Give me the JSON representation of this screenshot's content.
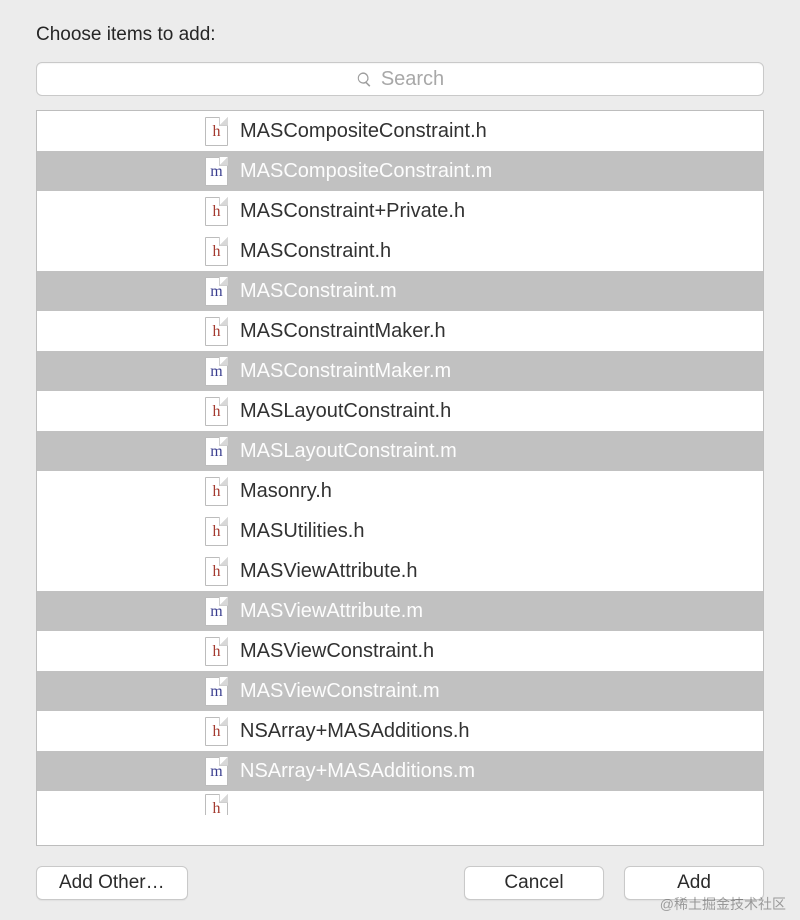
{
  "title": "Choose items to add:",
  "search": {
    "placeholder": "Search"
  },
  "files": [
    {
      "name": "MASCompositeConstraint.h",
      "kind": "h",
      "selected": false
    },
    {
      "name": "MASCompositeConstraint.m",
      "kind": "m",
      "selected": true
    },
    {
      "name": "MASConstraint+Private.h",
      "kind": "h",
      "selected": false
    },
    {
      "name": "MASConstraint.h",
      "kind": "h",
      "selected": false
    },
    {
      "name": "MASConstraint.m",
      "kind": "m",
      "selected": true
    },
    {
      "name": "MASConstraintMaker.h",
      "kind": "h",
      "selected": false
    },
    {
      "name": "MASConstraintMaker.m",
      "kind": "m",
      "selected": true
    },
    {
      "name": "MASLayoutConstraint.h",
      "kind": "h",
      "selected": false
    },
    {
      "name": "MASLayoutConstraint.m",
      "kind": "m",
      "selected": true
    },
    {
      "name": "Masonry.h",
      "kind": "h",
      "selected": false
    },
    {
      "name": "MASUtilities.h",
      "kind": "h",
      "selected": false
    },
    {
      "name": "MASViewAttribute.h",
      "kind": "h",
      "selected": false
    },
    {
      "name": "MASViewAttribute.m",
      "kind": "m",
      "selected": true
    },
    {
      "name": "MASViewConstraint.h",
      "kind": "h",
      "selected": false
    },
    {
      "name": "MASViewConstraint.m",
      "kind": "m",
      "selected": true
    },
    {
      "name": "NSArray+MASAdditions.h",
      "kind": "h",
      "selected": false
    },
    {
      "name": "NSArray+MASAdditions.m",
      "kind": "m",
      "selected": true
    },
    {
      "name": "",
      "kind": "h",
      "selected": false,
      "partial": true
    }
  ],
  "buttons": {
    "add_other": "Add Other…",
    "cancel": "Cancel",
    "add": "Add"
  },
  "watermark": "@稀土掘金技术社区"
}
